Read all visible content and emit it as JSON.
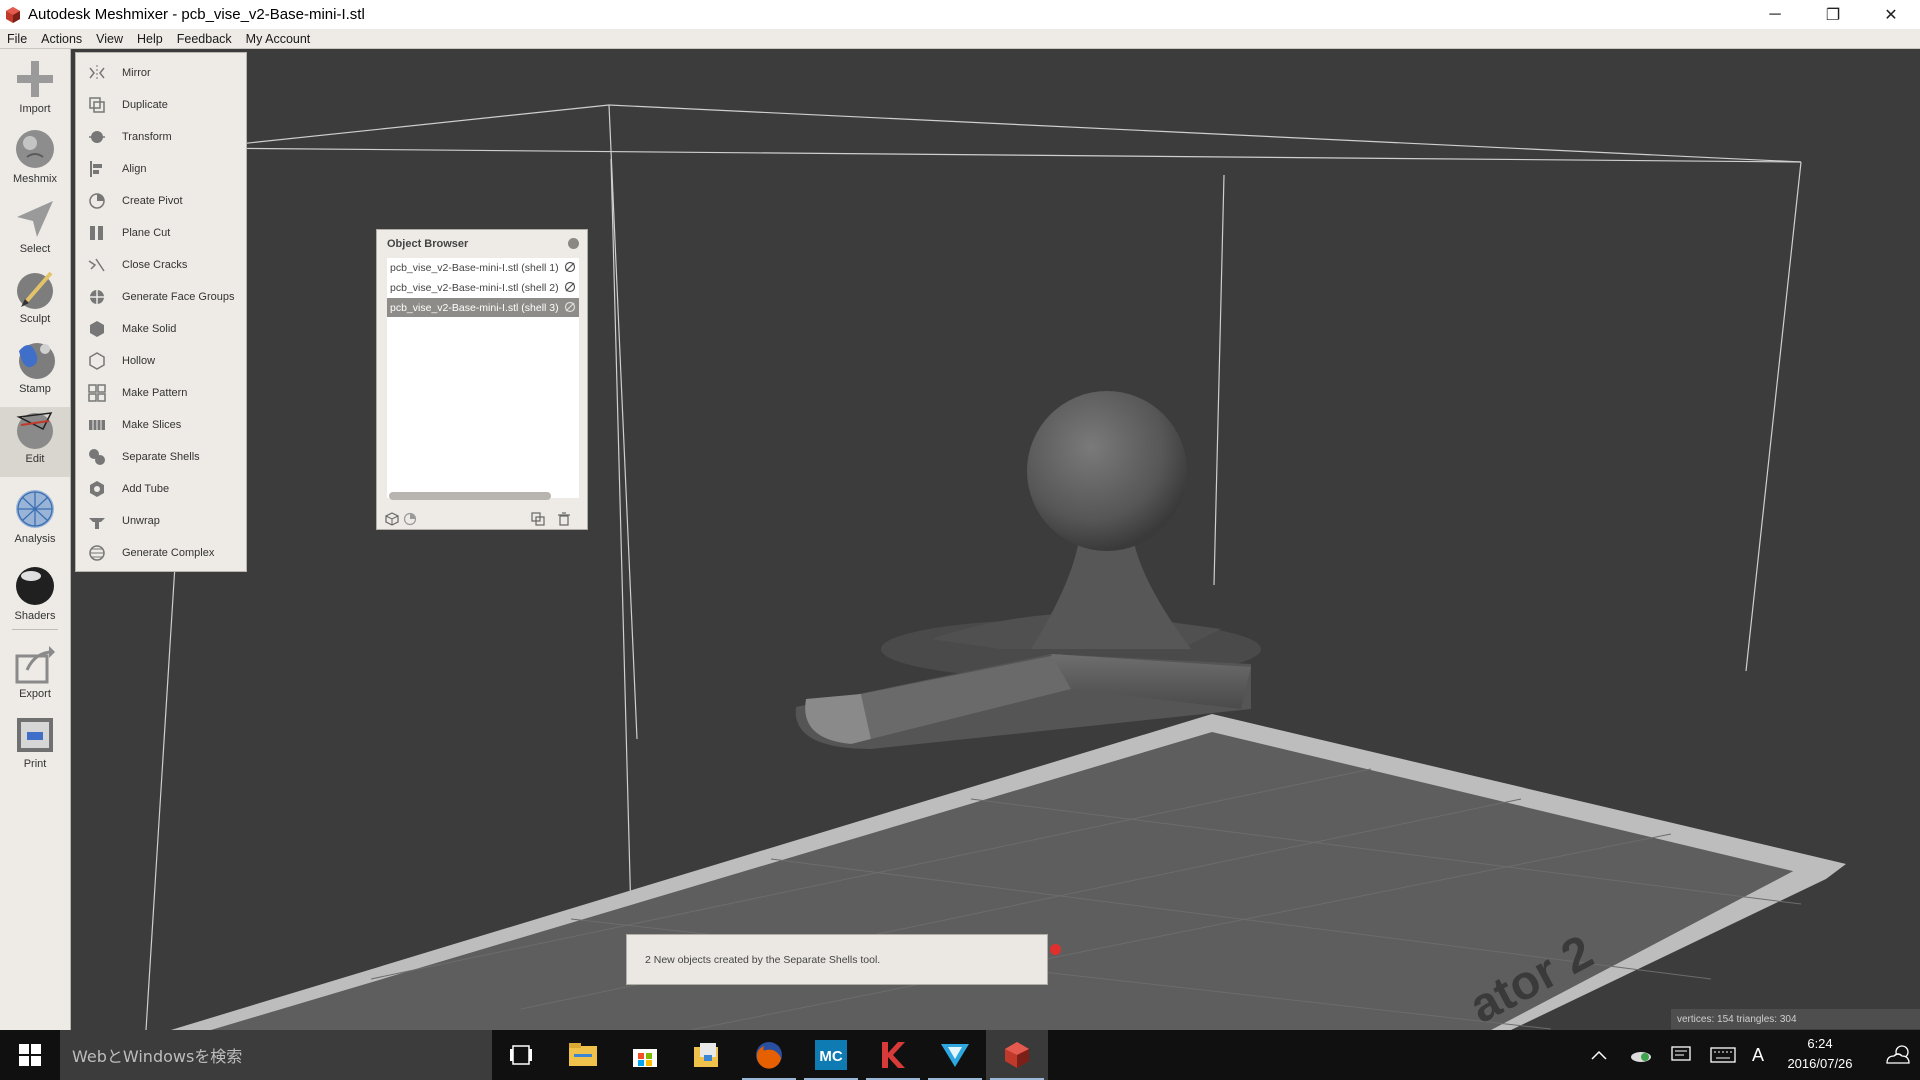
{
  "window": {
    "title": "Autodesk Meshmixer - pcb_vise_v2-Base-mini-I.stl",
    "app_icon": "meshmixer-icon",
    "controls": {
      "minimize": "─",
      "restore": "❐",
      "close": "✕"
    }
  },
  "menubar": {
    "items": [
      "File",
      "Actions",
      "View",
      "Help",
      "Feedback",
      "My Account"
    ]
  },
  "toolbar": {
    "tools": [
      {
        "label": "Import",
        "icon": "plus-icon"
      },
      {
        "label": "Meshmix",
        "icon": "meshmix-icon"
      },
      {
        "label": "Select",
        "icon": "select-arrow-icon"
      },
      {
        "label": "Sculpt",
        "icon": "sculpt-brush-icon"
      },
      {
        "label": "Stamp",
        "icon": "stamp-icon"
      },
      {
        "label": "Edit",
        "icon": "edit-icon",
        "active": true
      },
      {
        "label": "Analysis",
        "icon": "analysis-icon"
      },
      {
        "label": "Shaders",
        "icon": "shader-sphere-icon"
      },
      {
        "label": "Export",
        "icon": "export-icon"
      },
      {
        "label": "Print",
        "icon": "print-icon"
      }
    ]
  },
  "edit_menu": {
    "items": [
      {
        "label": "Mirror",
        "icon": "mirror-icon"
      },
      {
        "label": "Duplicate",
        "icon": "duplicate-icon"
      },
      {
        "label": "Transform",
        "icon": "transform-icon"
      },
      {
        "label": "Align",
        "icon": "align-icon"
      },
      {
        "label": "Create Pivot",
        "icon": "pivot-icon"
      },
      {
        "label": "Plane Cut",
        "icon": "plane-cut-icon"
      },
      {
        "label": "Close Cracks",
        "icon": "close-cracks-icon"
      },
      {
        "label": "Generate Face Groups",
        "icon": "face-groups-icon"
      },
      {
        "label": "Make Solid",
        "icon": "make-solid-icon"
      },
      {
        "label": "Hollow",
        "icon": "hollow-icon"
      },
      {
        "label": "Make Pattern",
        "icon": "pattern-icon"
      },
      {
        "label": "Make Slices",
        "icon": "slices-icon"
      },
      {
        "label": "Separate Shells",
        "icon": "separate-shells-icon"
      },
      {
        "label": "Add Tube",
        "icon": "tube-icon"
      },
      {
        "label": "Unwrap",
        "icon": "unwrap-icon"
      },
      {
        "label": "Generate Complex",
        "icon": "complex-icon"
      }
    ]
  },
  "object_browser": {
    "title": "Object Browser",
    "objects": [
      {
        "name": "pcb_vise_v2-Base-mini-I.stl (shell 1)",
        "selected": false
      },
      {
        "name": "pcb_vise_v2-Base-mini-I.stl (shell 2)",
        "selected": false
      },
      {
        "name": "pcb_vise_v2-Base-mini-I.stl (shell 3)",
        "selected": true
      }
    ]
  },
  "viewport": {
    "bed_label": "ator 2"
  },
  "toast": {
    "message": "2 New objects created by the Separate Shells tool."
  },
  "stats": {
    "text": "vertices: 154 triangles: 304"
  },
  "taskbar": {
    "search_placeholder": "WebとWindowsを検索",
    "apps": [
      "task-view-icon",
      "file-explorer-icon",
      "store-icon",
      "folder-icon",
      "firefox-icon",
      "mc-icon",
      "k-app-icon",
      "v-app-icon",
      "meshmixer-icon"
    ],
    "mc_label": "MC",
    "tray_ime": "A",
    "time": "6:24",
    "date": "2016/07/26"
  },
  "colors": {
    "panel_bg": "#eeebe7",
    "viewport_bg": "#3c3c3c",
    "selected_row": "#8e8c88",
    "taskbar": "#101010",
    "toast_dot": "#e0302e"
  }
}
